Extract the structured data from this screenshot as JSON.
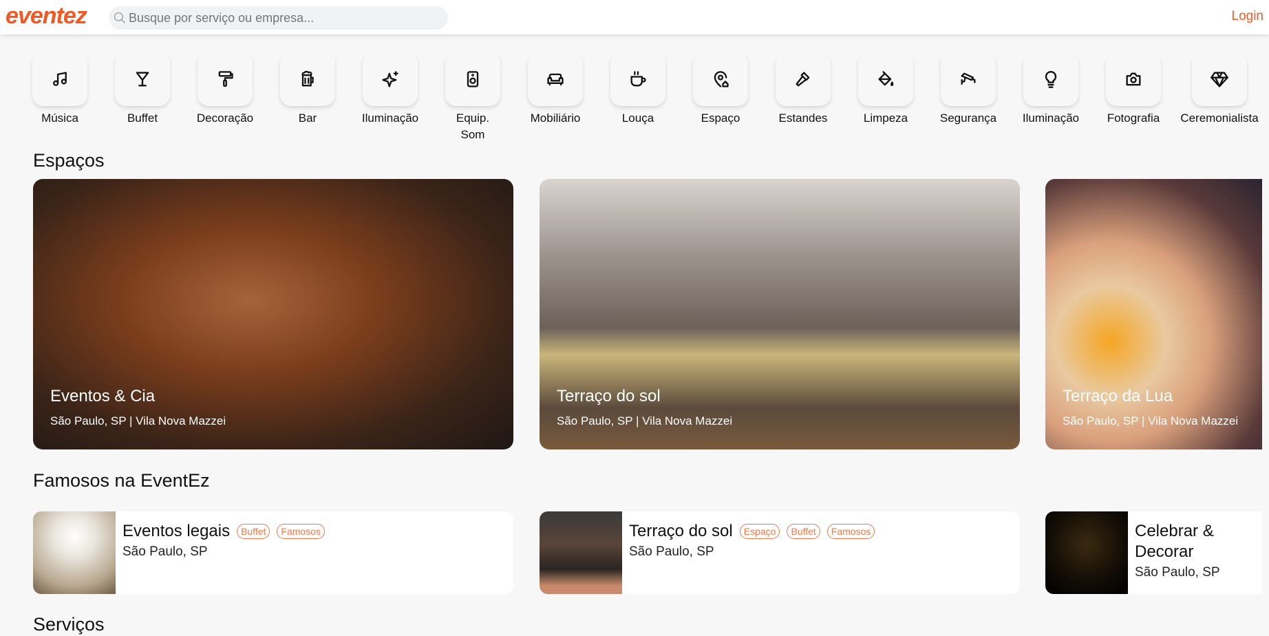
{
  "header": {
    "logo": "eventez",
    "search_placeholder": "Busque por serviço ou empresa...",
    "login": "Login",
    "accent": "#f15a24"
  },
  "categories": [
    {
      "label": "Música",
      "icon": "music-icon"
    },
    {
      "label": "Buffet",
      "icon": "cocktail-icon"
    },
    {
      "label": "Decoração",
      "icon": "paint-roller-icon"
    },
    {
      "label": "Bar",
      "icon": "beer-icon"
    },
    {
      "label": "Iluminação",
      "icon": "sparkles-icon"
    },
    {
      "label": "Equip. Som",
      "icon": "speaker-icon"
    },
    {
      "label": "Mobiliário",
      "icon": "sofa-icon"
    },
    {
      "label": "Louça",
      "icon": "cup-icon"
    },
    {
      "label": "Espaço",
      "icon": "location-home-icon"
    },
    {
      "label": "Estandes",
      "icon": "hammer-icon"
    },
    {
      "label": "Limpeza",
      "icon": "paint-bucket-icon"
    },
    {
      "label": "Segurança",
      "icon": "cctv-icon"
    },
    {
      "label": "Iluminação",
      "icon": "bulb-icon"
    },
    {
      "label": "Fotografia",
      "icon": "camera-icon"
    },
    {
      "label": "Ceremonialista",
      "icon": "diamond-icon"
    }
  ],
  "sections": {
    "spaces": "Espaços",
    "famous": "Famosos na EventEz",
    "services": "Serviços"
  },
  "spaces": [
    {
      "title": "Eventos & Cia",
      "subtitle": "São Paulo, SP | Vila Nova Mazzei"
    },
    {
      "title": "Terraço do sol",
      "subtitle": "São Paulo, SP | Vila Nova Mazzei"
    },
    {
      "title": "Terraço da Lua",
      "subtitle": "São Paulo, SP | Vila Nova Mazzei"
    }
  ],
  "famous": [
    {
      "name": "Eventos legais",
      "tags": [
        "Buffet",
        "Famosos"
      ],
      "location": "São Paulo, SP"
    },
    {
      "name": "Terraço do sol",
      "tags": [
        "Espaço",
        "Buffet",
        "Famosos"
      ],
      "location": "São Paulo, SP"
    },
    {
      "name": "Celebrar & Decorar",
      "tags": [],
      "location": "São Paulo, SP"
    }
  ]
}
